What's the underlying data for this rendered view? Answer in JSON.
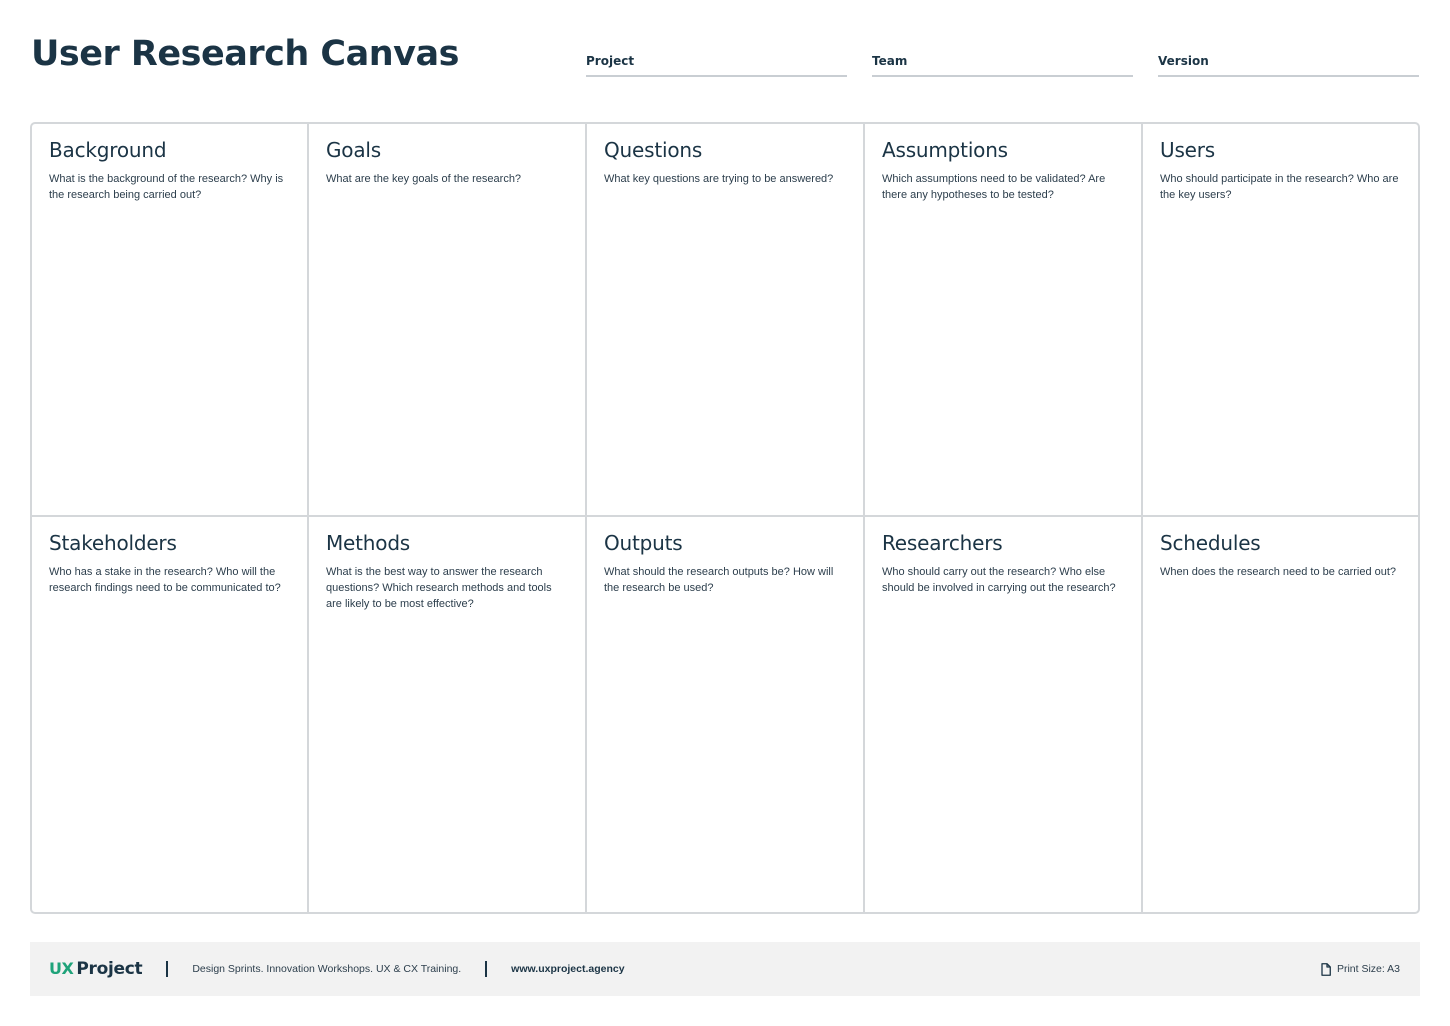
{
  "header": {
    "title": "User Research Canvas",
    "fields": {
      "project": "Project",
      "team": "Team",
      "version": "Version"
    }
  },
  "sections": [
    {
      "title": "Background",
      "prompt": "What is the background of the research? Why is the research being carried out?"
    },
    {
      "title": "Goals",
      "prompt": "What are the key goals of the research?"
    },
    {
      "title": "Questions",
      "prompt": "What key questions are trying to be answered?"
    },
    {
      "title": "Assumptions",
      "prompt": "Which assumptions need to be validated? Are there any hypotheses to be tested?"
    },
    {
      "title": "Users",
      "prompt": "Who should participate in the research? Who are the key users?"
    },
    {
      "title": "Stakeholders",
      "prompt": "Who has a stake in the research? Who will the research findings need to be communicated to?"
    },
    {
      "title": "Methods",
      "prompt": "What is the best way to answer the research questions? Which research methods and tools are likely to be most effective?"
    },
    {
      "title": "Outputs",
      "prompt": "What should the research outputs be? How will the research be used?"
    },
    {
      "title": "Researchers",
      "prompt": "Who should carry out the research? Who else should be involved in carrying out the research?"
    },
    {
      "title": "Schedules",
      "prompt": "When does the research need to be carried out?"
    }
  ],
  "footer": {
    "logo_ux": "UX",
    "logo_project": "Project",
    "tagline": "Design Sprints. Innovation Workshops. UX & CX Training.",
    "url": "www.uxproject.agency",
    "print_size": "Print Size: A3",
    "print_icon": "document-icon"
  },
  "colors": {
    "brand_dark": "#1b3445",
    "brand_green": "#1fa37a",
    "border": "#d4d7da",
    "footer_bg": "#f2f2f2"
  }
}
